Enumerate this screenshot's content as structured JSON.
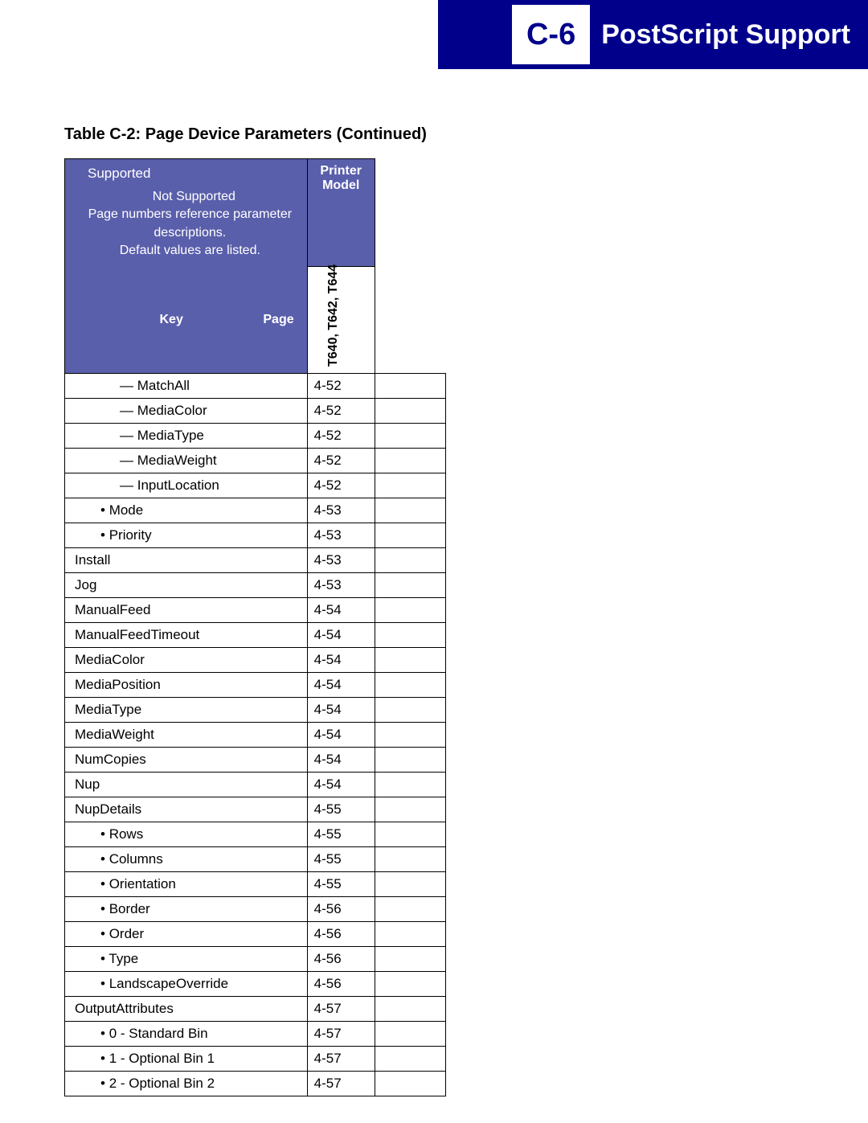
{
  "header": {
    "badge": "C-6",
    "title": "PostScript Support"
  },
  "caption": "Table C-2:   Page Device Parameters (Continued)",
  "legend": {
    "supported": "Supported",
    "not_supported": "Not Supported",
    "note1": "Page numbers reference parameter descriptions.",
    "note2": "Default values are listed.",
    "key": "Key",
    "page": "Page",
    "printer_model": "Printer Model",
    "model_col": "T640, T642, T644"
  },
  "rows": [
    {
      "key": "MatchAll",
      "page": "4-52",
      "indent": 2,
      "marker": "dash"
    },
    {
      "key": "MediaColor",
      "page": "4-52",
      "indent": 2,
      "marker": "dash"
    },
    {
      "key": "MediaType",
      "page": "4-52",
      "indent": 2,
      "marker": "dash"
    },
    {
      "key": "MediaWeight",
      "page": "4-52",
      "indent": 2,
      "marker": "dash"
    },
    {
      "key": "InputLocation",
      "page": "4-52",
      "indent": 2,
      "marker": "dash"
    },
    {
      "key": "Mode",
      "page": "4-53",
      "indent": 1,
      "marker": "bullet"
    },
    {
      "key": "Priority",
      "page": "4-53",
      "indent": 1,
      "marker": "bullet"
    },
    {
      "key": "Install",
      "page": "4-53",
      "indent": 0,
      "marker": ""
    },
    {
      "key": "Jog",
      "page": "4-53",
      "indent": 0,
      "marker": ""
    },
    {
      "key": "ManualFeed",
      "page": "4-54",
      "indent": 0,
      "marker": ""
    },
    {
      "key": "ManualFeedTimeout",
      "page": "4-54",
      "indent": 0,
      "marker": ""
    },
    {
      "key": "MediaColor",
      "page": "4-54",
      "indent": 0,
      "marker": ""
    },
    {
      "key": "MediaPosition",
      "page": "4-54",
      "indent": 0,
      "marker": ""
    },
    {
      "key": "MediaType",
      "page": "4-54",
      "indent": 0,
      "marker": ""
    },
    {
      "key": "MediaWeight",
      "page": "4-54",
      "indent": 0,
      "marker": ""
    },
    {
      "key": "NumCopies",
      "page": "4-54",
      "indent": 0,
      "marker": ""
    },
    {
      "key": "Nup",
      "page": "4-54",
      "indent": 0,
      "marker": ""
    },
    {
      "key": "NupDetails",
      "page": "4-55",
      "indent": 0,
      "marker": ""
    },
    {
      "key": "Rows",
      "page": "4-55",
      "indent": 1,
      "marker": "bullet"
    },
    {
      "key": "Columns",
      "page": "4-55",
      "indent": 1,
      "marker": "bullet"
    },
    {
      "key": "Orientation",
      "page": "4-55",
      "indent": 1,
      "marker": "bullet"
    },
    {
      "key": "Border",
      "page": "4-56",
      "indent": 1,
      "marker": "bullet"
    },
    {
      "key": "Order",
      "page": "4-56",
      "indent": 1,
      "marker": "bullet"
    },
    {
      "key": "Type",
      "page": "4-56",
      "indent": 1,
      "marker": "bullet"
    },
    {
      "key": "LandscapeOverride",
      "page": "4-56",
      "indent": 1,
      "marker": "bullet"
    },
    {
      "key": "OutputAttributes",
      "page": "4-57",
      "indent": 0,
      "marker": ""
    },
    {
      "key": "0 - Standard Bin",
      "page": "4-57",
      "indent": 1,
      "marker": "bullet"
    },
    {
      "key": "1 - Optional Bin 1",
      "page": "4-57",
      "indent": 1,
      "marker": "bullet"
    },
    {
      "key": "2 - Optional Bin 2",
      "page": "4-57",
      "indent": 1,
      "marker": "bullet"
    }
  ]
}
